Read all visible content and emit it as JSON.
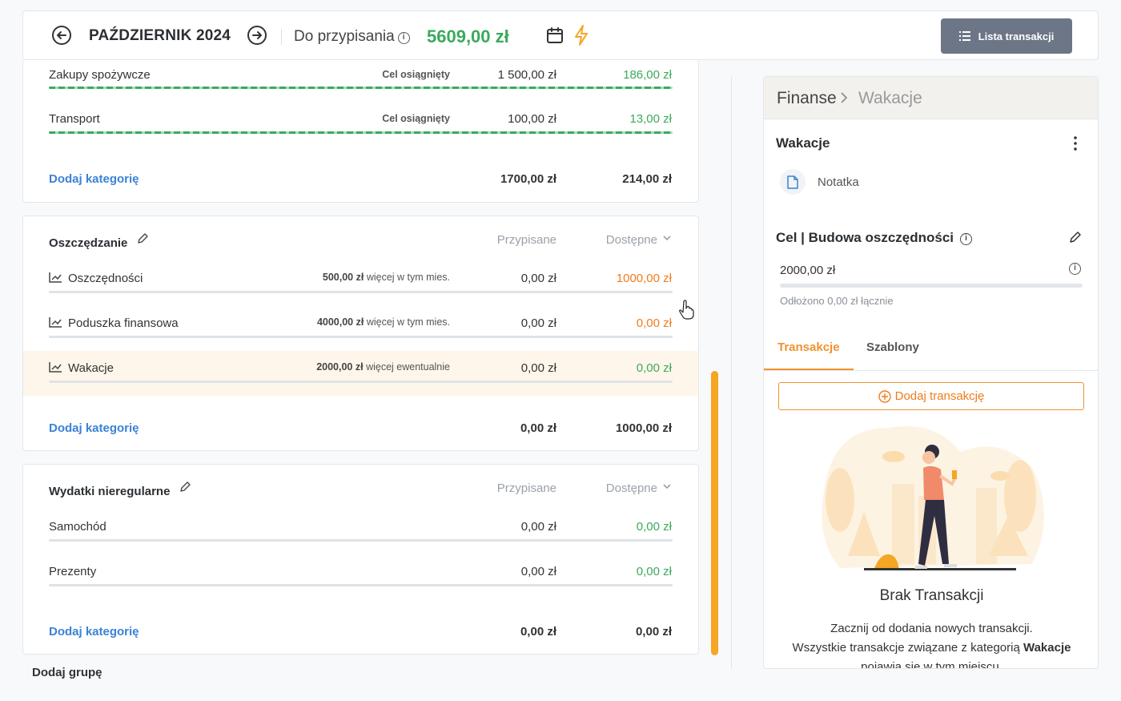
{
  "header": {
    "month": "PAŹDZIERNIK 2024",
    "assign_label": "Do przypisania",
    "assign_value": "5609,00 zł",
    "list_button": "Lista transakcji"
  },
  "group1": {
    "rows": [
      {
        "name": "Zakupy spożywcze",
        "goal": "Cel osiągnięty",
        "assigned": "1 500,00 zł",
        "available": "186,00 zł"
      },
      {
        "name": "Transport",
        "goal": "Cel osiągnięty",
        "assigned": "100,00 zł",
        "available": "13,00 zł"
      }
    ],
    "add_category": "Dodaj kategorię",
    "total_assigned": "1700,00 zł",
    "total_available": "214,00 zł"
  },
  "group2": {
    "title": "Oszczędzanie",
    "col_assigned": "Przypisane",
    "col_available": "Dostępne",
    "rows": [
      {
        "name": "Oszczędności",
        "goal_amount": "500,00 zł",
        "goal_text": "więcej w tym mies.",
        "assigned": "0,00 zł",
        "available": "1000,00 zł"
      },
      {
        "name": "Poduszka finansowa",
        "goal_amount": "4000,00 zł",
        "goal_text": "więcej w tym mies.",
        "assigned": "0,00 zł",
        "available": "0,00 zł"
      },
      {
        "name": "Wakacje",
        "goal_amount": "2000,00 zł",
        "goal_text": "więcej ewentualnie",
        "assigned": "0,00 zł",
        "available": "0,00 zł"
      }
    ],
    "add_category": "Dodaj kategorię",
    "total_assigned": "0,00 zł",
    "total_available": "1000,00 zł"
  },
  "group3": {
    "title": "Wydatki nieregularne",
    "col_assigned": "Przypisane",
    "col_available": "Dostępne",
    "rows": [
      {
        "name": "Samochód",
        "assigned": "0,00 zł",
        "available": "0,00 zł"
      },
      {
        "name": "Prezenty",
        "assigned": "0,00 zł",
        "available": "0,00 zł"
      }
    ],
    "add_category": "Dodaj kategorię",
    "total_assigned": "0,00 zł",
    "total_available": "0,00 zł"
  },
  "add_group": "Dodaj grupę",
  "panel": {
    "breadcrumb_root": "Finanse",
    "breadcrumb_current": "Wakacje",
    "title": "Wakacje",
    "note": "Notatka",
    "goal_title": "Cel | Budowa oszczędności",
    "goal_amount": "2000,00 zł",
    "goal_progress": 0,
    "goal_saved": "Odłożono 0,00 zł łącznie",
    "tab_transactions": "Transakcje",
    "tab_templates": "Szablony",
    "add_transaction": "Dodaj transakcję",
    "empty_title": "Brak Transakcji",
    "empty_line1": "Zacznij od dodania nowych transakcji.",
    "empty_line2_pre": "Wszystkie transakcje związane z kategorią",
    "empty_line2_bold": "Wakacje",
    "empty_line3": "pojawią się w tym miejscu."
  },
  "colors": {
    "accent": "#f0922e",
    "positive": "#3aaa5c",
    "warning": "#f07c1c",
    "link": "#3b82d6",
    "button": "#6c7686"
  }
}
